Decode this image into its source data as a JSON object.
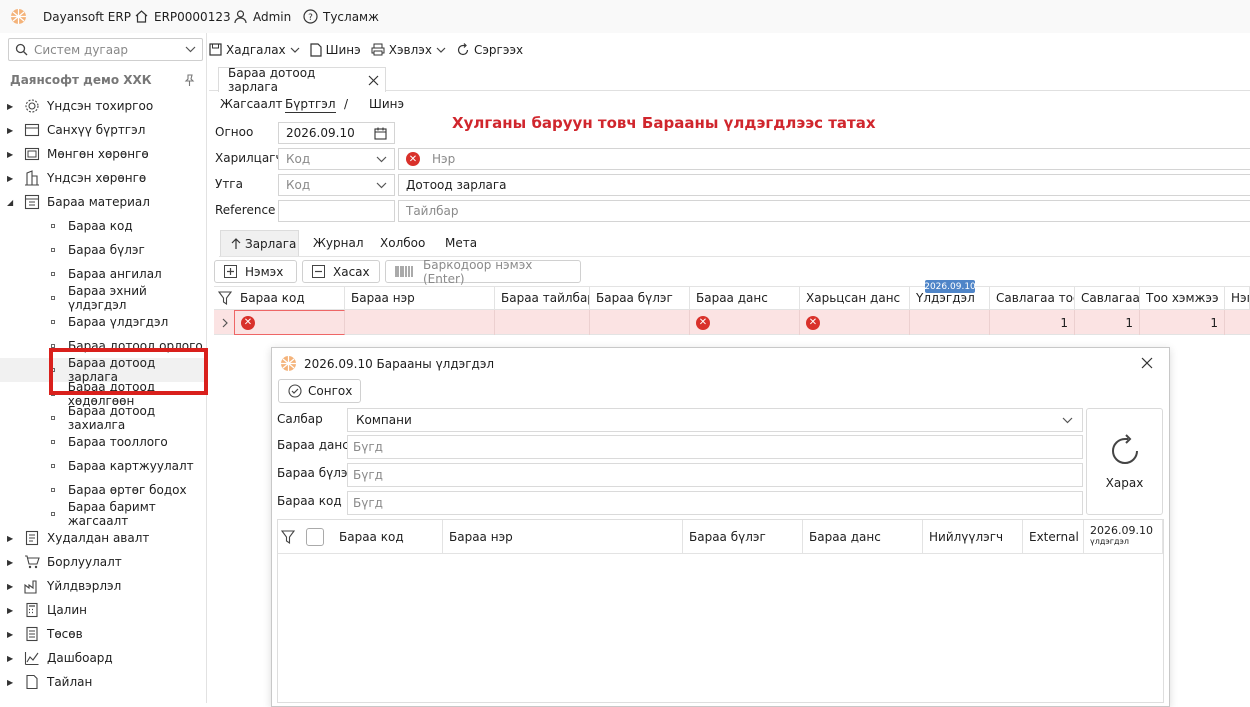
{
  "topbar": {
    "app_name": "Dayansoft ERP",
    "system_code": "ERP0000123",
    "user": "Admin",
    "help": "Тусламж"
  },
  "sidebar": {
    "search_placeholder": "Систем дугаар",
    "company": "Даянсофт демо ХХК",
    "groups": [
      {
        "label": "Үндсэн тохиргоо",
        "icon": "gear-icon"
      },
      {
        "label": "Санхүү бүртгэл",
        "icon": "ledger-icon"
      },
      {
        "label": "Мөнгөн хөрөнгө",
        "icon": "money-icon"
      },
      {
        "label": "Үндсэн хөрөнгө",
        "icon": "building-icon"
      },
      {
        "label": "Бараа материал",
        "icon": "inventory-icon"
      }
    ],
    "inventory_items": [
      "Бараа код",
      "Бараа бүлэг",
      "Бараа ангилал",
      "Бараа эхний үлдэгдэл",
      "Бараа үлдэгдэл",
      "Бараа дотоод орлого",
      "Бараа дотоод зарлага",
      "Бараа дотоод хөдөлгөөн",
      "Бараа дотоод захиалга",
      "Бараа тооллого",
      "Бараа картжуулалт",
      "Бараа өртөг бодох",
      "Бараа баримт жагсаалт"
    ],
    "bottom_groups": [
      {
        "label": "Худалдан авалт",
        "icon": "purchase-icon"
      },
      {
        "label": "Борлуулалт",
        "icon": "cart-icon"
      },
      {
        "label": "Үйлдвэрлэл",
        "icon": "factory-icon"
      },
      {
        "label": "Цалин",
        "icon": "calculator-icon"
      },
      {
        "label": "Төсөв",
        "icon": "budget-icon"
      },
      {
        "label": "Дашбоард",
        "icon": "dashboard-icon"
      },
      {
        "label": "Тайлан",
        "icon": "report-icon"
      }
    ]
  },
  "toolbar": {
    "save": "Хадгалах",
    "new": "Шинэ",
    "print": "Хэвлэх",
    "refresh": "Сэргээх"
  },
  "doc_tab": {
    "title": "Бараа дотоод зарлага"
  },
  "breadcrumb": {
    "list": "Жагсаалт",
    "register": "Бүртгэл",
    "sep": "/",
    "new": "Шинэ"
  },
  "form": {
    "date_label": "Огноо",
    "date_value": "2026.09.10",
    "partner_label": "Харилцагч",
    "partner_code_ph": "Код",
    "partner_name_ph": "Нэр",
    "type_label": "Утга",
    "type_code_ph": "Код",
    "type_value": "Дотоод зарлага",
    "reference_label": "Reference",
    "description_ph": "Тайлбар"
  },
  "hint": "Хулганы баруун товч Барааны үлдэгдлээс татах",
  "subtabs": [
    "Зарлага",
    "Журнал",
    "Холбоо",
    "Мета"
  ],
  "line_actions": {
    "add": "Нэмэх",
    "remove": "Хасах",
    "barcode_ph": "Баркодоор нэмэх (Enter)"
  },
  "grid": {
    "date_badge": "2026.09.10",
    "columns": [
      "Бараа код",
      "Бараа нэр",
      "Бараа тайлбар",
      "Бараа бүлэг",
      "Бараа данс",
      "Харьцсан данс",
      "Үлдэгдэл",
      "Савлагаа тоо",
      "Савлагаа",
      "Тоо хэмжээ",
      "Нэг"
    ],
    "row": {
      "pack_qty": "1",
      "pack": "1",
      "qty": "1"
    }
  },
  "dialog": {
    "title": "2026.09.10 Барааны үлдэгдэл",
    "select_btn": "Сонгох",
    "branch_label": "Салбар",
    "branch_value": "Компани",
    "account_label": "Бараа данс",
    "account_ph": "Бүгд",
    "group_label": "Бараа бүлэг",
    "group_ph": "Бүгд",
    "code_label": "Бараа код",
    "code_ph": "Бүгд",
    "view_btn": "Харах",
    "columns": [
      "Бараа код",
      "Бараа нэр",
      "Бараа бүлэг",
      "Бараа данс",
      "Нийлүүлэгч",
      "External c"
    ],
    "balance_col_date": "2026.09.10",
    "balance_col_label": "үлдэгдэл"
  }
}
